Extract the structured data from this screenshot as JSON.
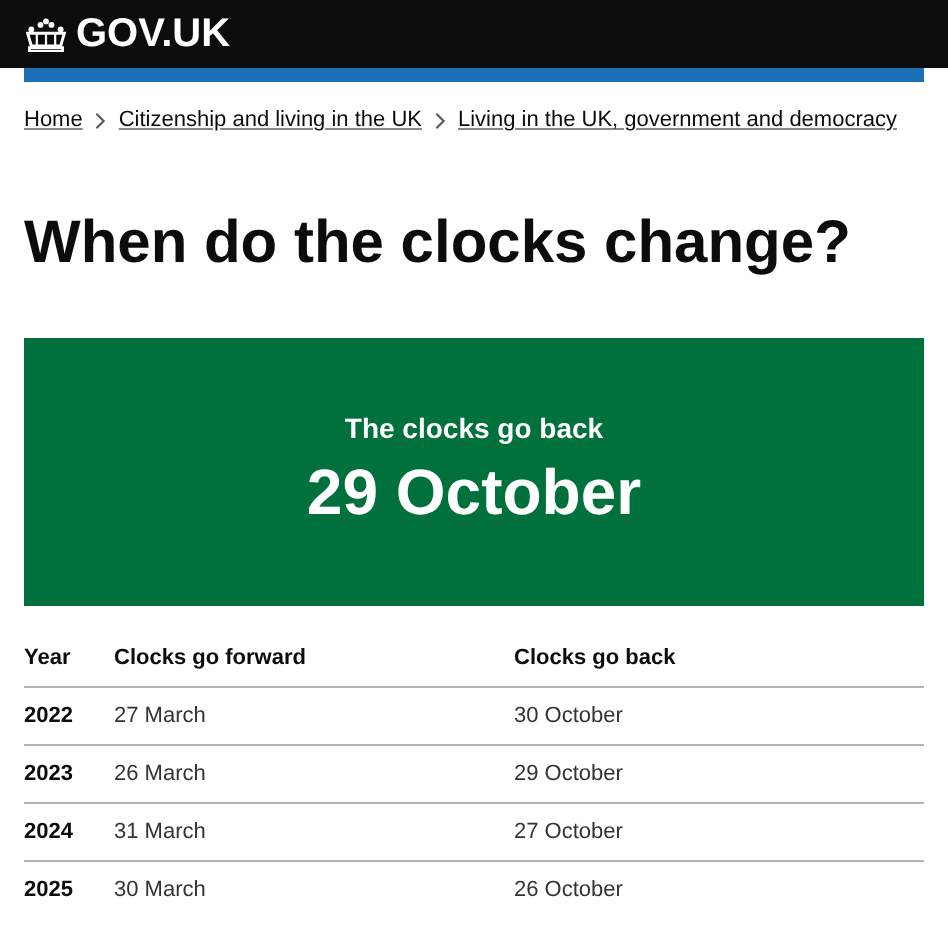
{
  "header": {
    "logo_text": "GOV.UK"
  },
  "breadcrumbs": [
    "Home",
    "Citizenship and living in the UK",
    "Living in the UK, government and democracy"
  ],
  "title": "When do the clocks change?",
  "highlight": {
    "caption": "The clocks go back",
    "date": "29 October"
  },
  "table": {
    "columns": [
      "Year",
      "Clocks go forward",
      "Clocks go back"
    ],
    "rows": [
      [
        "2022",
        "27 March",
        "30 October"
      ],
      [
        "2023",
        "26 March",
        "29 October"
      ],
      [
        "2024",
        "31 March",
        "27 October"
      ],
      [
        "2025",
        "30 March",
        "26 October"
      ]
    ]
  }
}
